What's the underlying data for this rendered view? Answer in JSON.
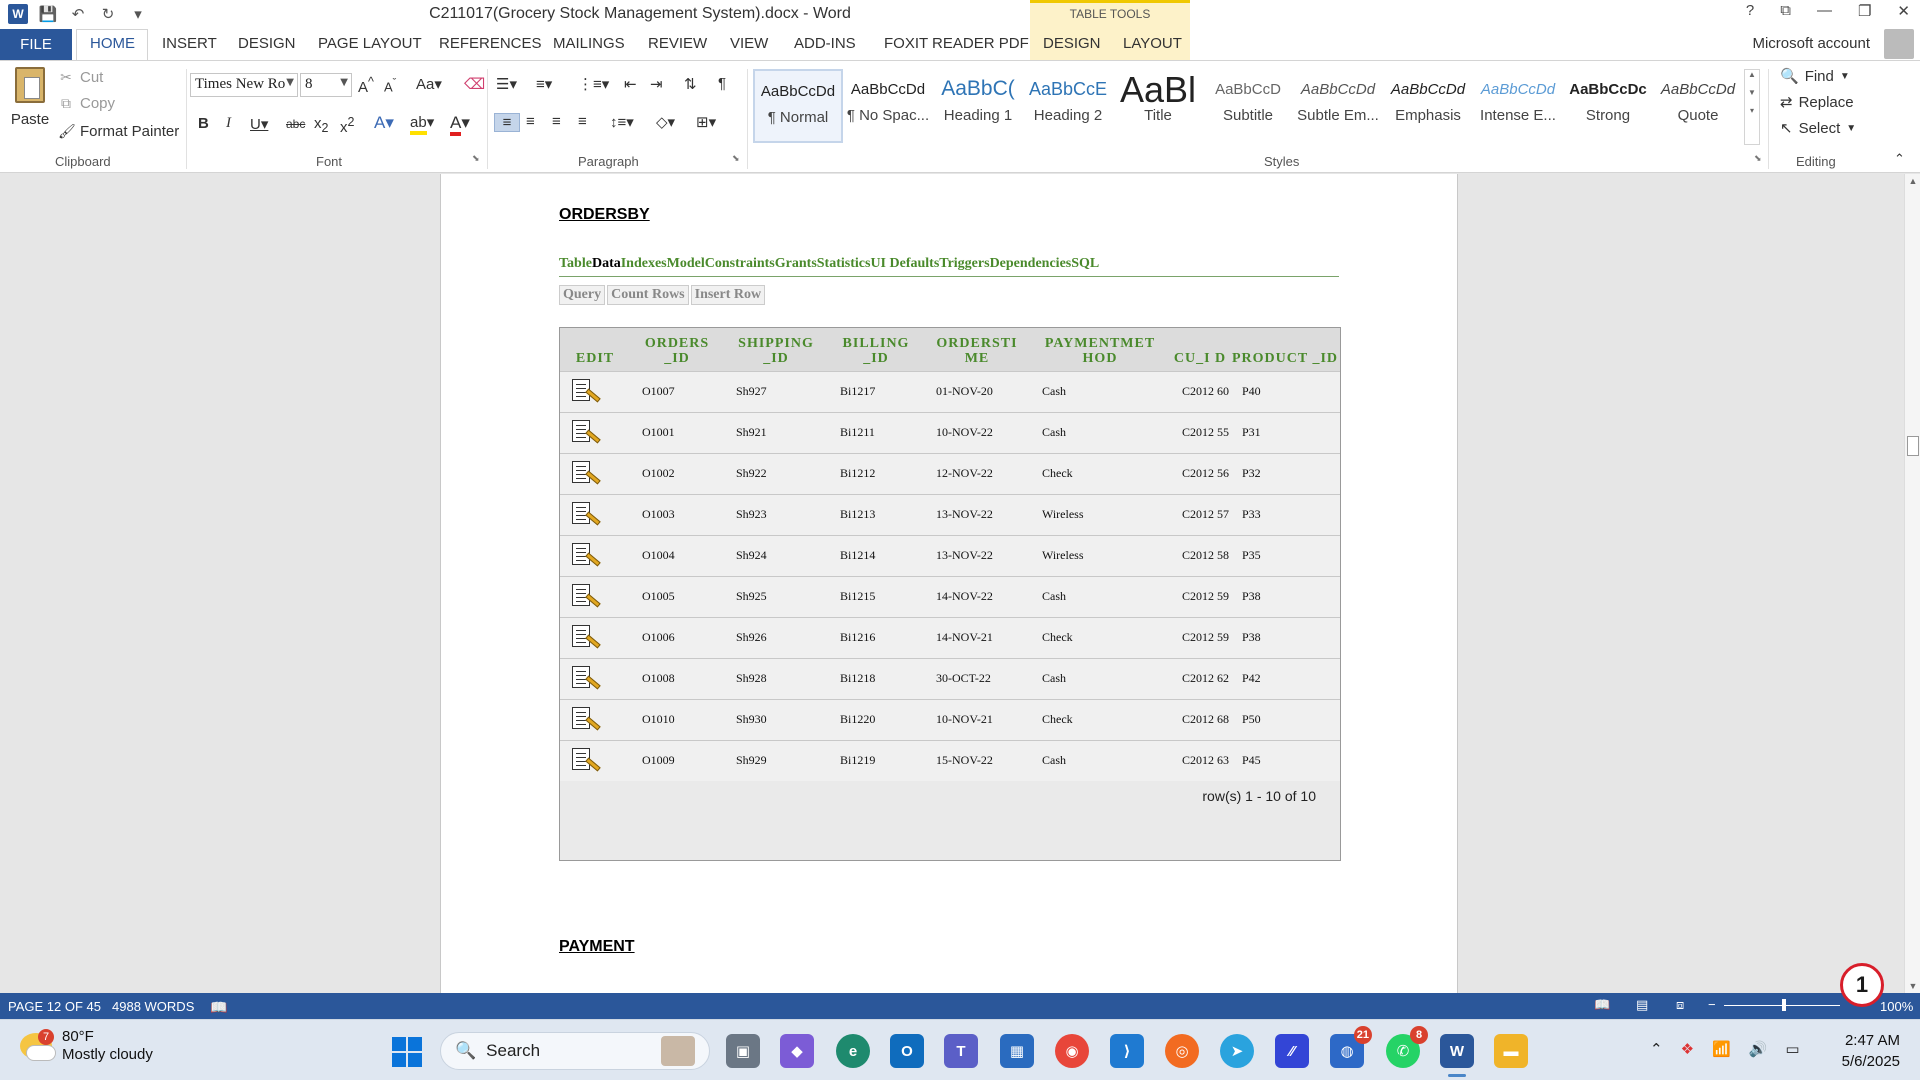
{
  "titlebar": {
    "app_icon": "W",
    "doc_title": "C211017(Grocery Stock Management System).docx - Word",
    "table_tools": "TABLE TOOLS",
    "controls": [
      "?",
      "⧉",
      "—",
      "❐",
      "✕"
    ]
  },
  "tabs": {
    "file": "FILE",
    "items": [
      "HOME",
      "INSERT",
      "DESIGN",
      "PAGE LAYOUT",
      "REFERENCES",
      "MAILINGS",
      "REVIEW",
      "VIEW",
      "ADD-INS",
      "FOXIT READER PDF",
      "DESIGN",
      "LAYOUT"
    ],
    "account": "Microsoft account"
  },
  "ribbon": {
    "clipboard": {
      "paste": "Paste",
      "cut": "Cut",
      "copy": "Copy",
      "format_painter": "Format Painter",
      "label": "Clipboard"
    },
    "font": {
      "name": "Times New Ro",
      "size": "8",
      "label": "Font"
    },
    "paragraph": {
      "label": "Paragraph"
    },
    "styles": {
      "label": "Styles",
      "items": [
        {
          "sample": "AaBbCcDd",
          "name": "¶ Normal"
        },
        {
          "sample": "AaBbCcDd",
          "name": "¶ No Spac..."
        },
        {
          "sample": "AaBbC(",
          "name": "Heading 1"
        },
        {
          "sample": "AaBbCcE",
          "name": "Heading 2"
        },
        {
          "sample": "AaBl",
          "name": "Title"
        },
        {
          "sample": "AaBbCcD",
          "name": "Subtitle"
        },
        {
          "sample": "AaBbCcDd",
          "name": "Subtle Em..."
        },
        {
          "sample": "AaBbCcDd",
          "name": "Emphasis"
        },
        {
          "sample": "AaBbCcDd",
          "name": "Intense E..."
        },
        {
          "sample": "AaBbCcDc",
          "name": "Strong"
        },
        {
          "sample": "AaBbCcDd",
          "name": "Quote"
        }
      ]
    },
    "editing": {
      "find": "Find",
      "replace": "Replace",
      "select": "Select",
      "label": "Editing"
    }
  },
  "document": {
    "section_title": "ORDERSBY",
    "nav_links": [
      "Table",
      "Data",
      "Indexes",
      "Model",
      "Constraints",
      "Grants",
      "Statistics",
      "UI Defaults",
      "Triggers",
      "Dependencies",
      "SQL"
    ],
    "current_link": "Data",
    "query_buttons": [
      "Query",
      "Count Rows",
      "Insert Row"
    ],
    "table": {
      "headers": [
        "EDIT",
        "ORDERS _ID",
        "SHIPPING _ID",
        "BILLING _ID",
        "ORDERSTI ME",
        "PAYMENTMET HOD",
        "CU_I D",
        "PRODUCT _ID"
      ],
      "rows": [
        [
          "O1007",
          "Sh927",
          "Bi1217",
          "01-NOV-20",
          "Cash",
          "C2012 60",
          "P40"
        ],
        [
          "O1001",
          "Sh921",
          "Bi1211",
          "10-NOV-22",
          "Cash",
          "C2012 55",
          "P31"
        ],
        [
          "O1002",
          "Sh922",
          "Bi1212",
          "12-NOV-22",
          "Check",
          "C2012 56",
          "P32"
        ],
        [
          "O1003",
          "Sh923",
          "Bi1213",
          "13-NOV-22",
          "Wireless",
          "C2012 57",
          "P33"
        ],
        [
          "O1004",
          "Sh924",
          "Bi1214",
          "13-NOV-22",
          "Wireless",
          "C2012 58",
          "P35"
        ],
        [
          "O1005",
          "Sh925",
          "Bi1215",
          "14-NOV-22",
          "Cash",
          "C2012 59",
          "P38"
        ],
        [
          "O1006",
          "Sh926",
          "Bi1216",
          "14-NOV-21",
          "Check",
          "C2012 59",
          "P38"
        ],
        [
          "O1008",
          "Sh928",
          "Bi1218",
          "30-OCT-22",
          "Cash",
          "C2012 62",
          "P42"
        ],
        [
          "O1010",
          "Sh930",
          "Bi1220",
          "10-NOV-21",
          "Check",
          "C2012 68",
          "P50"
        ],
        [
          "O1009",
          "Sh929",
          "Bi1219",
          "15-NOV-22",
          "Cash",
          "C2012 63",
          "P45"
        ]
      ],
      "row_count": "row(s) 1 - 10 of 10"
    },
    "next_section_title": "PAYMENT"
  },
  "statusbar": {
    "page": "PAGE 12 OF 45",
    "words": "4988 WORDS",
    "zoom": "100%",
    "badge": "1"
  },
  "taskbar": {
    "weather_badge": "7",
    "temperature": "80°F",
    "weather": "Mostly cloudy",
    "search_placeholder": "Search",
    "badges": {
      "app1": "21",
      "whatsapp": "8"
    },
    "time": "2:47 AM",
    "date": "5/6/2025"
  },
  "colors": {
    "word_blue": "#2b579a",
    "link_green": "#4a8a2c",
    "context_yellow": "#fdf2c9"
  }
}
